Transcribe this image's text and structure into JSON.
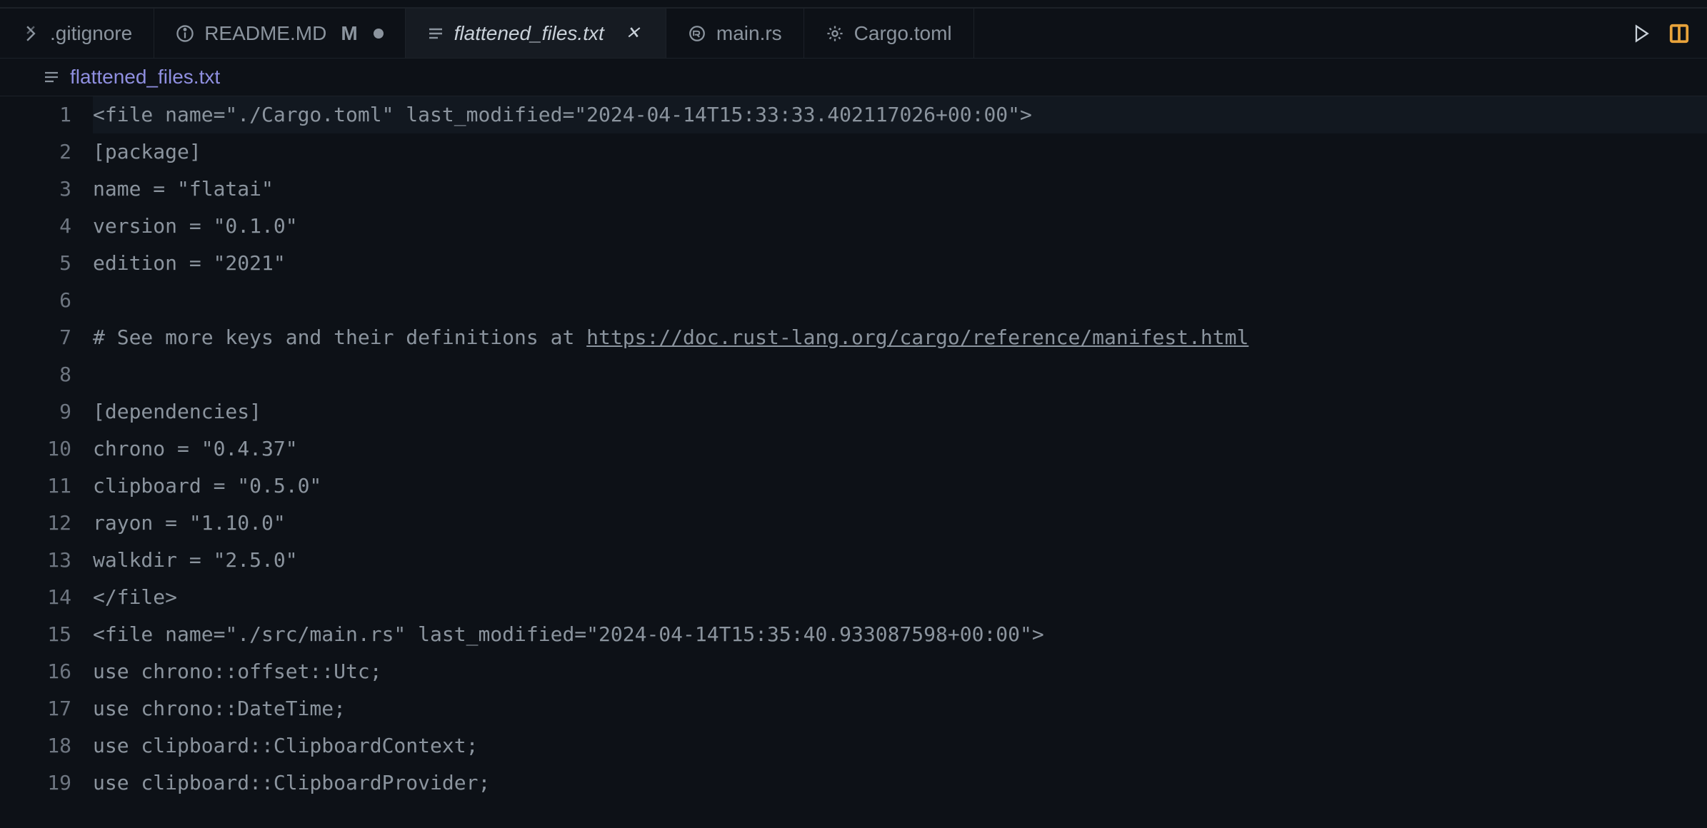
{
  "tabs": [
    {
      "icon": "diff",
      "label": ".gitignore",
      "status": "",
      "active": false,
      "dirty": false
    },
    {
      "icon": "info",
      "label": "README.MD",
      "status": "M",
      "active": false,
      "dirty": true
    },
    {
      "icon": "lines",
      "label": "flattened_files.txt",
      "status": "",
      "active": true,
      "dirty": false
    },
    {
      "icon": "rust",
      "label": "main.rs",
      "status": "",
      "active": false,
      "dirty": false
    },
    {
      "icon": "gear",
      "label": "Cargo.toml",
      "status": "",
      "active": false,
      "dirty": false
    }
  ],
  "breadcrumb": {
    "icon": "lines",
    "label": "flattened_files.txt"
  },
  "editor": {
    "lines": [
      "<file name=\"./Cargo.toml\" last_modified=\"2024-04-14T15:33:33.402117026+00:00\">",
      "[package]",
      "name = \"flatai\"",
      "version = \"0.1.0\"",
      "edition = \"2021\"",
      "",
      "# See more keys and their definitions at https://doc.rust-lang.org/cargo/reference/manifest.html",
      "",
      "[dependencies]",
      "chrono = \"0.4.37\"",
      "clipboard = \"0.5.0\"",
      "rayon = \"1.10.0\"",
      "walkdir = \"2.5.0\"",
      "</file>",
      "<file name=\"./src/main.rs\" last_modified=\"2024-04-14T15:35:40.933087598+00:00\">",
      "use chrono::offset::Utc;",
      "use chrono::DateTime;",
      "use clipboard::ClipboardContext;",
      "use clipboard::ClipboardProvider;"
    ],
    "link_line_index": 6,
    "link_prefix": "# See more keys and their definitions at ",
    "link_url": "https://doc.rust-lang.org/cargo/reference/manifest.html",
    "current_line": 0
  },
  "actions": {
    "run": "run",
    "layout": "layout"
  }
}
